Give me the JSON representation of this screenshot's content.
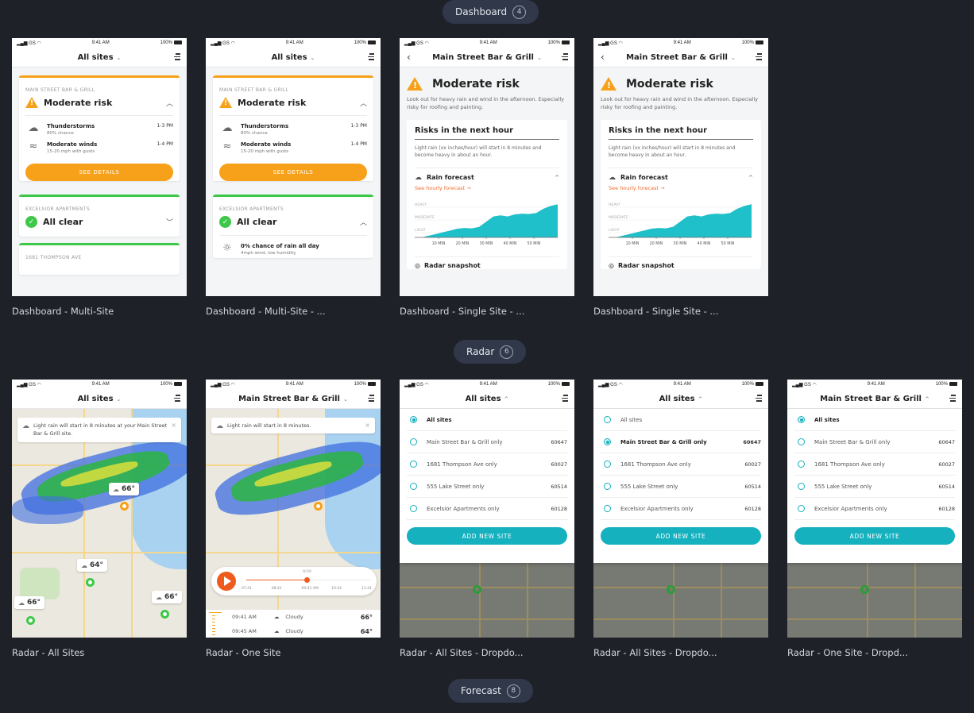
{
  "sections": [
    {
      "name": "Dashboard",
      "count": "4",
      "artboards": [
        {
          "label": "Dashboard - Multi-Site",
          "status": {
            "carrier": "GS",
            "time": "9:41 AM",
            "battery": "100%"
          },
          "nav_title": "All sites",
          "cards": [
            {
              "site": "MAIN STREET BAR & GRILL",
              "level": "Moderate risk",
              "risks": [
                {
                  "title": "Thunderstorms",
                  "sub": "80% chance",
                  "time": "1-3 PM"
                },
                {
                  "title": "Moderate winds",
                  "sub": "15-20 mph with gusts",
                  "time": "1-4 PM"
                }
              ],
              "button": "SEE DETAILS"
            },
            {
              "site": "EXCELSIOR APARTMENTS",
              "level": "All clear"
            },
            {
              "site": "1681 THOMPSON AVE"
            }
          ]
        },
        {
          "label": "Dashboard - Multi-Site - ...",
          "status": {
            "carrier": "GS",
            "time": "9:41 AM",
            "battery": "100%"
          },
          "nav_title": "All sites",
          "cards": [
            {
              "site": "MAIN STREET BAR & GRILL",
              "level": "Moderate risk",
              "risks": [
                {
                  "title": "Thunderstorms",
                  "sub": "80% chance",
                  "time": "1-3 PM"
                },
                {
                  "title": "Moderate winds",
                  "sub": "15-20 mph with gusts",
                  "time": "1-4 PM"
                }
              ],
              "button": "SEE DETAILS"
            },
            {
              "site": "EXCELSIOR APARTMENTS",
              "level": "All clear",
              "detail": {
                "title": "0% chance of rain all day",
                "sub": "4mph wind, low humidity"
              }
            }
          ]
        },
        {
          "label": "Dashboard - Single Site - ...",
          "status": {
            "carrier": "GS",
            "time": "9:41 AM",
            "battery": "100%"
          },
          "nav_title": "Main Street Bar & Grill",
          "level": "Moderate risk",
          "desc": "Look out for heavy rain and wind in the afternoon. Especially risky for roofing and painting.",
          "hour_title": "Risks in the next hour",
          "hour_desc": "Light rain (xx inches/hour) will start in 8 minutes and become heavy in about an hour.",
          "rain_title": "Rain forecast",
          "rain_link": "See hourly forecast →",
          "radar_title": "Radar snapshot"
        },
        {
          "label": "Dashboard - Single Site - ...",
          "status": {
            "carrier": "GS",
            "time": "9:41 AM",
            "battery": "100%"
          },
          "nav_title": "Main Street Bar & Grill",
          "level": "Moderate risk",
          "desc": "Look out for heavy rain and wind in the afternoon. Especially risky for roofing and painting.",
          "hour_title": "Risks in the next hour",
          "hour_desc": "Light rain (xx inches/hour) will start in 8 minutes and become heavy in about an hour.",
          "rain_title": "Rain forecast",
          "rain_link": "See hourly forecast →",
          "radar_title": "Radar snapshot"
        }
      ]
    },
    {
      "name": "Radar",
      "count": "6",
      "artboards": [
        {
          "label": "Radar - All Sites",
          "status": {
            "carrier": "GS",
            "time": "9:41 AM",
            "battery": "100%"
          },
          "nav_title": "All sites",
          "toast": "Light rain will start in 8 minutes at your Main Street Bar & Grill site.",
          "temps": [
            "66°",
            "64°",
            "66°",
            "66°"
          ]
        },
        {
          "label": "Radar - One Site",
          "status": {
            "carrier": "GS",
            "time": "9:41 AM",
            "battery": "100%"
          },
          "nav_title": "Main Street Bar & Grill",
          "toast": "Light rain will start in 8 minutes.",
          "timeline": {
            "now_label": "NOW",
            "ticks": [
              "07:41",
              "08:41",
              "09:41 AM",
              "10:41",
              "11:41"
            ],
            "progress": 0.5
          },
          "hourly": [
            {
              "time": "09:41 AM",
              "cond": "Cloudy",
              "temp": "66°"
            },
            {
              "time": "09:45 AM",
              "cond": "Cloudy",
              "temp": "64°"
            }
          ]
        },
        {
          "label": "Radar - All Sites - Dropdo...",
          "status": {
            "carrier": "GS",
            "time": "9:41 AM",
            "battery": "100%"
          },
          "nav_title": "All sites",
          "selected": 0
        },
        {
          "label": "Radar - All Sites - Dropdo...",
          "status": {
            "carrier": "GS",
            "time": "9:41 AM",
            "battery": "100%"
          },
          "nav_title": "All sites",
          "selected": 1
        },
        {
          "label": "Radar - One Site - Dropd...",
          "status": {
            "carrier": "GS",
            "time": "9:41 AM",
            "battery": "100%"
          },
          "nav_title": "Main Street Bar & Grill",
          "selected": 0
        }
      ]
    },
    {
      "name": "Forecast",
      "count": "8"
    }
  ],
  "site_options": [
    {
      "label": "All sites",
      "zip": ""
    },
    {
      "label": "Main Street Bar & Grill only",
      "zip": "60647"
    },
    {
      "label": "1681 Thompson Ave only",
      "zip": "60027"
    },
    {
      "label": "555 Lake Street only",
      "zip": "60514"
    },
    {
      "label": "Excelsior Apartments only",
      "zip": "60128"
    }
  ],
  "add_site_label": "ADD NEW SITE",
  "rain_chart": {
    "y_levels": [
      "HEAVY",
      "MODERATE",
      "LIGHT"
    ],
    "x_ticks": [
      "10 MIN",
      "20 MIN",
      "30 MIN",
      "40 MIN",
      "50 MIN"
    ],
    "intensity": [
      0,
      0,
      0.05,
      0.1,
      0.15,
      0.2,
      0.25,
      0.27,
      0.26,
      0.3,
      0.45,
      0.6,
      0.63,
      0.6,
      0.66,
      0.68,
      0.67,
      0.7,
      0.82,
      0.9,
      0.95
    ],
    "color": "#1fc0c9"
  },
  "colors": {
    "orange": "#f7a11a",
    "green": "#3ec84a",
    "teal": "#15b1bf",
    "play": "#ef5a1d"
  }
}
